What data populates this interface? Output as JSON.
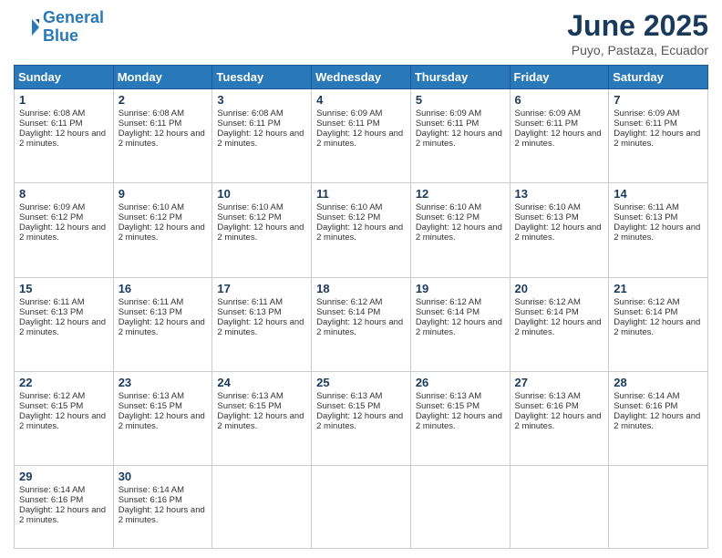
{
  "logo": {
    "line1": "General",
    "line2": "Blue"
  },
  "title": "June 2025",
  "location": "Puyo, Pastaza, Ecuador",
  "days_header": [
    "Sunday",
    "Monday",
    "Tuesday",
    "Wednesday",
    "Thursday",
    "Friday",
    "Saturday"
  ],
  "weeks": [
    [
      {
        "day": "1",
        "sunrise": "6:08 AM",
        "sunset": "6:11 PM",
        "daylight": "12 hours and 2 minutes."
      },
      {
        "day": "2",
        "sunrise": "6:08 AM",
        "sunset": "6:11 PM",
        "daylight": "12 hours and 2 minutes."
      },
      {
        "day": "3",
        "sunrise": "6:08 AM",
        "sunset": "6:11 PM",
        "daylight": "12 hours and 2 minutes."
      },
      {
        "day": "4",
        "sunrise": "6:09 AM",
        "sunset": "6:11 PM",
        "daylight": "12 hours and 2 minutes."
      },
      {
        "day": "5",
        "sunrise": "6:09 AM",
        "sunset": "6:11 PM",
        "daylight": "12 hours and 2 minutes."
      },
      {
        "day": "6",
        "sunrise": "6:09 AM",
        "sunset": "6:11 PM",
        "daylight": "12 hours and 2 minutes."
      },
      {
        "day": "7",
        "sunrise": "6:09 AM",
        "sunset": "6:11 PM",
        "daylight": "12 hours and 2 minutes."
      }
    ],
    [
      {
        "day": "8",
        "sunrise": "6:09 AM",
        "sunset": "6:12 PM",
        "daylight": "12 hours and 2 minutes."
      },
      {
        "day": "9",
        "sunrise": "6:10 AM",
        "sunset": "6:12 PM",
        "daylight": "12 hours and 2 minutes."
      },
      {
        "day": "10",
        "sunrise": "6:10 AM",
        "sunset": "6:12 PM",
        "daylight": "12 hours and 2 minutes."
      },
      {
        "day": "11",
        "sunrise": "6:10 AM",
        "sunset": "6:12 PM",
        "daylight": "12 hours and 2 minutes."
      },
      {
        "day": "12",
        "sunrise": "6:10 AM",
        "sunset": "6:12 PM",
        "daylight": "12 hours and 2 minutes."
      },
      {
        "day": "13",
        "sunrise": "6:10 AM",
        "sunset": "6:13 PM",
        "daylight": "12 hours and 2 minutes."
      },
      {
        "day": "14",
        "sunrise": "6:11 AM",
        "sunset": "6:13 PM",
        "daylight": "12 hours and 2 minutes."
      }
    ],
    [
      {
        "day": "15",
        "sunrise": "6:11 AM",
        "sunset": "6:13 PM",
        "daylight": "12 hours and 2 minutes."
      },
      {
        "day": "16",
        "sunrise": "6:11 AM",
        "sunset": "6:13 PM",
        "daylight": "12 hours and 2 minutes."
      },
      {
        "day": "17",
        "sunrise": "6:11 AM",
        "sunset": "6:13 PM",
        "daylight": "12 hours and 2 minutes."
      },
      {
        "day": "18",
        "sunrise": "6:12 AM",
        "sunset": "6:14 PM",
        "daylight": "12 hours and 2 minutes."
      },
      {
        "day": "19",
        "sunrise": "6:12 AM",
        "sunset": "6:14 PM",
        "daylight": "12 hours and 2 minutes."
      },
      {
        "day": "20",
        "sunrise": "6:12 AM",
        "sunset": "6:14 PM",
        "daylight": "12 hours and 2 minutes."
      },
      {
        "day": "21",
        "sunrise": "6:12 AM",
        "sunset": "6:14 PM",
        "daylight": "12 hours and 2 minutes."
      }
    ],
    [
      {
        "day": "22",
        "sunrise": "6:12 AM",
        "sunset": "6:15 PM",
        "daylight": "12 hours and 2 minutes."
      },
      {
        "day": "23",
        "sunrise": "6:13 AM",
        "sunset": "6:15 PM",
        "daylight": "12 hours and 2 minutes."
      },
      {
        "day": "24",
        "sunrise": "6:13 AM",
        "sunset": "6:15 PM",
        "daylight": "12 hours and 2 minutes."
      },
      {
        "day": "25",
        "sunrise": "6:13 AM",
        "sunset": "6:15 PM",
        "daylight": "12 hours and 2 minutes."
      },
      {
        "day": "26",
        "sunrise": "6:13 AM",
        "sunset": "6:15 PM",
        "daylight": "12 hours and 2 minutes."
      },
      {
        "day": "27",
        "sunrise": "6:13 AM",
        "sunset": "6:16 PM",
        "daylight": "12 hours and 2 minutes."
      },
      {
        "day": "28",
        "sunrise": "6:14 AM",
        "sunset": "6:16 PM",
        "daylight": "12 hours and 2 minutes."
      }
    ],
    [
      {
        "day": "29",
        "sunrise": "6:14 AM",
        "sunset": "6:16 PM",
        "daylight": "12 hours and 2 minutes."
      },
      {
        "day": "30",
        "sunrise": "6:14 AM",
        "sunset": "6:16 PM",
        "daylight": "12 hours and 2 minutes."
      },
      null,
      null,
      null,
      null,
      null
    ]
  ]
}
